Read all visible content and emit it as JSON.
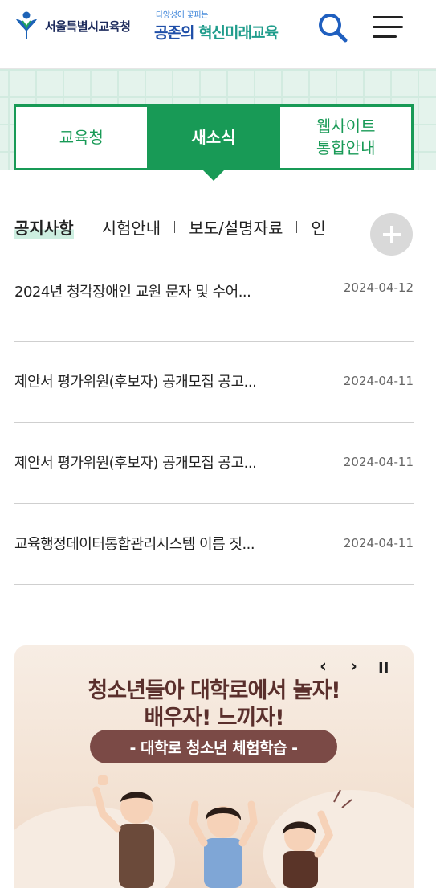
{
  "header": {
    "org_name": "서울특별시교육청",
    "slogan_small": "다양성이 꽃피는",
    "slogan_main_1": "공존의 ",
    "slogan_main_2": "혁신미래교육"
  },
  "tabs": [
    {
      "label": "교육청",
      "active": false
    },
    {
      "label": "새소식",
      "active": true
    },
    {
      "label": "웹사이트\n통합안내",
      "active": false
    }
  ],
  "subnav": {
    "items": [
      "공지사항",
      "시험안내",
      "보도/설명자료",
      "인"
    ],
    "active_index": 0
  },
  "news": [
    {
      "title": "2024년 청각장애인 교원 문자 및 수어...",
      "date": "2024-04-12"
    },
    {
      "title": "제안서 평가위원(후보자) 공개모집 공고...",
      "date": "2024-04-11"
    },
    {
      "title": "제안서 평가위원(후보자) 공개모집 공고...",
      "date": "2024-04-11"
    },
    {
      "title": "교육행정데이터통합관리시스템 이름 짓...",
      "date": "2024-04-11"
    }
  ],
  "banner": {
    "line1": "청소년들아 대학로에서 놀자!",
    "line2": "배우자! 느끼자!",
    "pill": "- 대학로 청소년 체험학습 -",
    "prev_icon": "‹",
    "next_icon": "›",
    "pause_icon": "II"
  },
  "colors": {
    "accent_green": "#189a56",
    "brand_navy": "#1d2b5c",
    "banner_brown": "#7b4a46"
  },
  "icons": [
    "logo-mark-icon",
    "search-icon",
    "hamburger-menu-icon",
    "plus-icon",
    "prev-arrow-icon",
    "next-arrow-icon",
    "pause-icon"
  ]
}
